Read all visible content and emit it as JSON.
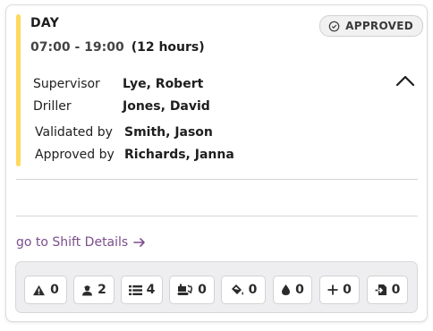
{
  "shift": {
    "title": "DAY",
    "time_range": "07:00 - 19:00",
    "duration": "(12 hours)",
    "status": "APPROVED",
    "accent_color": "#ffd85e",
    "details": [
      {
        "label": "Supervisor",
        "value": "Lye, Robert"
      },
      {
        "label": "Driller",
        "value": "Jones, David"
      }
    ],
    "approvals": [
      {
        "label": "Validated by",
        "value": "Smith, Jason"
      },
      {
        "label": "Approved by",
        "value": "Richards, Janna"
      }
    ]
  },
  "link": {
    "label": "go to Shift Details"
  },
  "stats": [
    {
      "icon": "warning-icon",
      "count": "0"
    },
    {
      "icon": "person-icon",
      "count": "2"
    },
    {
      "icon": "list-icon",
      "count": "4"
    },
    {
      "icon": "drill-rig-icon",
      "count": "0"
    },
    {
      "icon": "paint-bucket-icon",
      "count": "0"
    },
    {
      "icon": "water-drop-icon",
      "count": "0"
    },
    {
      "icon": "plus-icon",
      "count": "0"
    },
    {
      "icon": "file-import-icon",
      "count": "0"
    }
  ]
}
